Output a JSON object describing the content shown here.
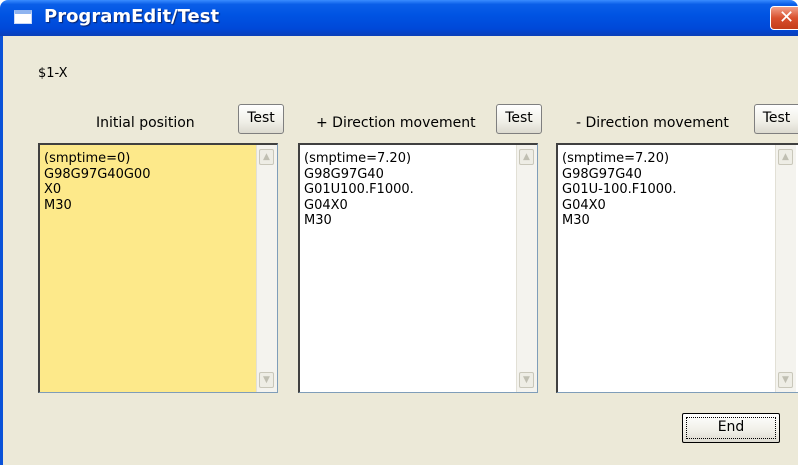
{
  "window": {
    "title": "ProgramEdit/Test",
    "close_label": "✕"
  },
  "axis_label": "$1-X",
  "panels": [
    {
      "label": "Initial position",
      "test_label": "Test",
      "program": "(smptime=0)\nG98G97G40G00\nX0\nM30"
    },
    {
      "label": "+ Direction movement",
      "test_label": "Test",
      "program": "(smptime=7.20)\nG98G97G40\nG01U100.F1000.\nG04X0\nM30"
    },
    {
      "label": "- Direction movement",
      "test_label": "Test",
      "program": "(smptime=7.20)\nG98G97G40\nG01U-100.F1000.\nG04X0\nM30"
    }
  ],
  "end_label": "End",
  "colors": {
    "titlebar": "#0054e3",
    "client_bg": "#ece9d8",
    "initial_textbox_bg": "#fde98a",
    "close_button": "#d9502e"
  },
  "icons": {
    "window": "window-icon",
    "close": "close-icon",
    "scroll_up": "scroll-up-arrow-icon",
    "scroll_down": "scroll-down-arrow-icon"
  }
}
